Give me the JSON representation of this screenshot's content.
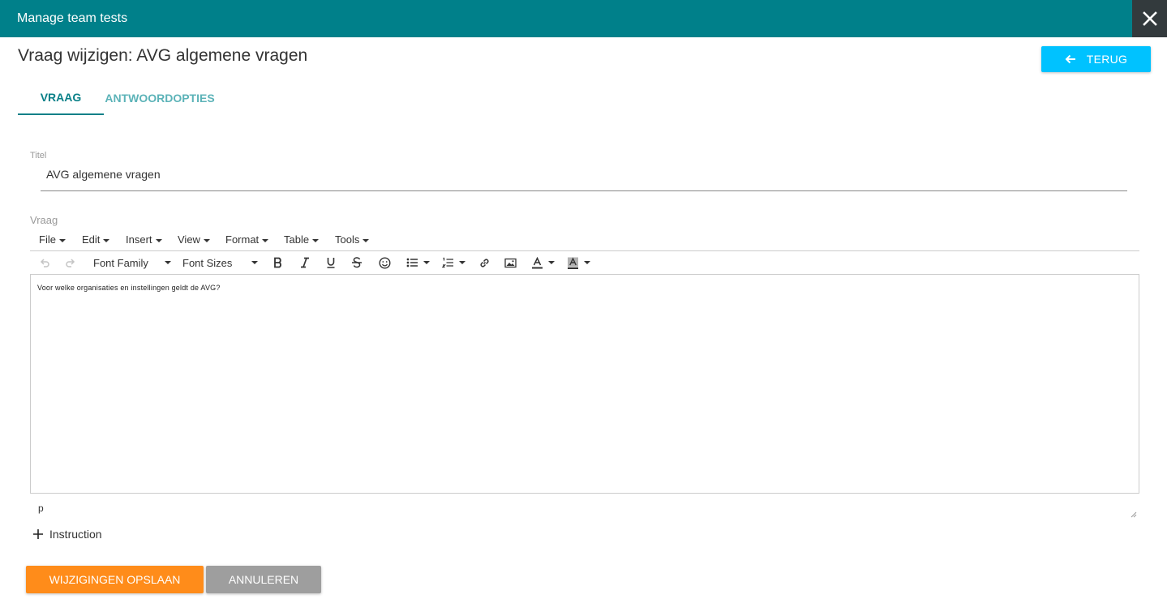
{
  "window": {
    "title": "Manage team tests",
    "close_icon": "close-icon"
  },
  "header": {
    "page_title": "Vraag wijzigen: AVG algemene vragen",
    "back_label": "TERUG",
    "back_icon": "arrow-left-icon"
  },
  "tabs": [
    {
      "label": "VRAAG",
      "active": true
    },
    {
      "label": "ANTWOORDOPTIES",
      "active": false
    }
  ],
  "title_field": {
    "label": "Titel",
    "value": "AVG algemene vragen"
  },
  "question_editor": {
    "label": "Vraag",
    "menu": [
      "File",
      "Edit",
      "Insert",
      "View",
      "Format",
      "Table",
      "Tools"
    ],
    "font_family": "Font Family",
    "font_sizes": "Font Sizes",
    "content": "Voor welke organisaties en instellingen geldt de AVG?",
    "path": "p"
  },
  "instruction": {
    "label": "Instruction",
    "icon": "plus-icon"
  },
  "actions": {
    "save_label": "WIJZIGINGEN OPSLAAN",
    "cancel_label": "ANNULEREN"
  },
  "colors": {
    "topbar": "#00808a",
    "close_bg": "#333a3d",
    "back_button": "#00c2ff",
    "tab_active": "#0a8088",
    "tab_inactive": "#5cb3b8",
    "save": "#ff8c1a",
    "cancel": "#9e9e9e"
  }
}
